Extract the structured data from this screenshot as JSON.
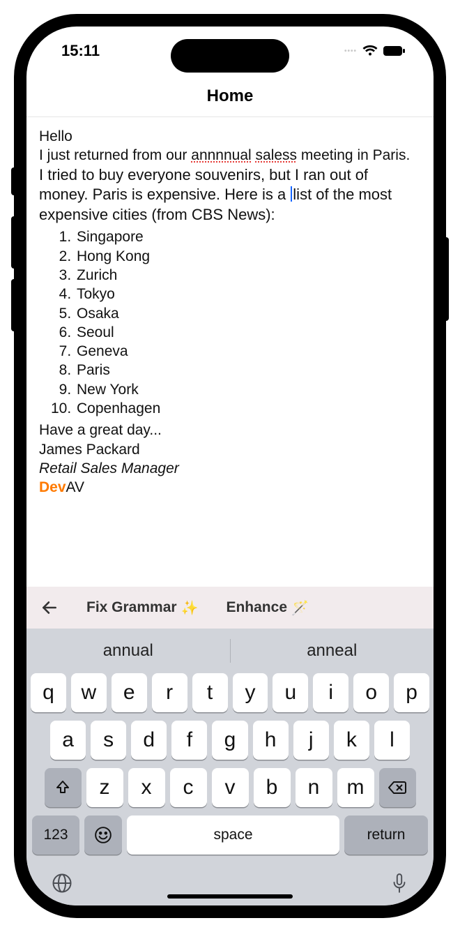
{
  "status": {
    "time": "15:11"
  },
  "nav": {
    "title": "Home"
  },
  "editor": {
    "greeting": "Hello",
    "para1_pre": "I just returned from our ",
    "para1_err1": "annnnual",
    "para1_mid": " ",
    "para1_err2": "saless",
    "para1_post": " meeting in Paris.",
    "para2_a": "I tried to buy everyone souvenirs, but I ran out of money. Paris is expensive. Here is a ",
    "para2_b": "list of the most expensive cities (from CBS News):",
    "list": [
      "Singapore",
      "Hong Kong",
      "Zurich",
      "Tokyo",
      "Osaka",
      "Seoul",
      "Geneva",
      "Paris",
      "New York",
      "Copenhagen"
    ],
    "closing": "Have a great day...",
    "sig_name": "James Packard",
    "sig_title": "Retail Sales Manager",
    "sig_brand_dev": "Dev",
    "sig_brand_av": "AV"
  },
  "ai_bar": {
    "fix_label": "Fix Grammar",
    "enhance_label": "Enhance"
  },
  "keyboard": {
    "suggestions": [
      "annual",
      "anneal"
    ],
    "row1": [
      "q",
      "w",
      "e",
      "r",
      "t",
      "y",
      "u",
      "i",
      "o",
      "p"
    ],
    "row2": [
      "a",
      "s",
      "d",
      "f",
      "g",
      "h",
      "j",
      "k",
      "l"
    ],
    "row3": [
      "z",
      "x",
      "c",
      "v",
      "b",
      "n",
      "m"
    ],
    "num_label": "123",
    "space_label": "space",
    "return_label": "return"
  }
}
